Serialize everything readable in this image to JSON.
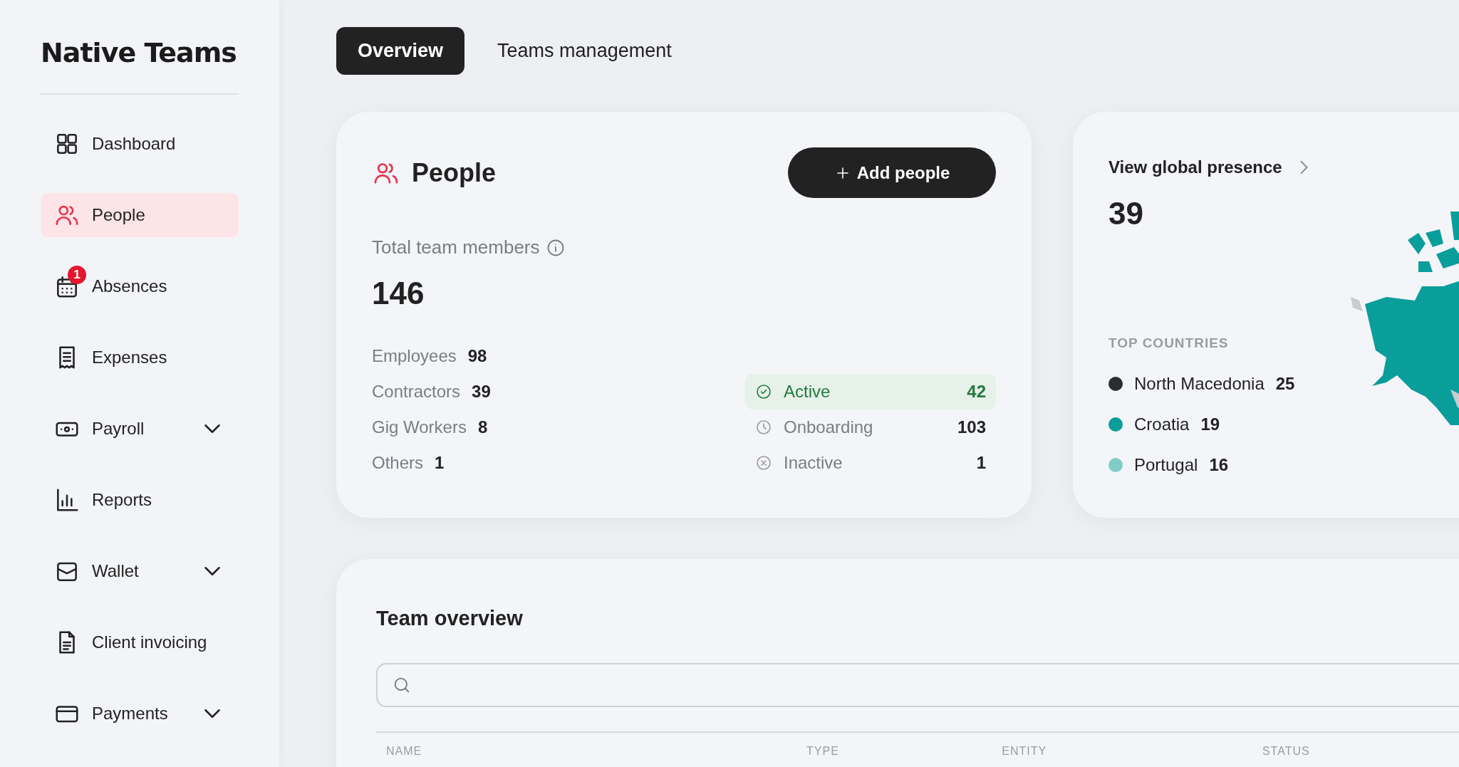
{
  "logo": "Native Teams",
  "sidebar": {
    "items": [
      {
        "label": "Dashboard",
        "selected": false,
        "expandable": false
      },
      {
        "label": "People",
        "selected": true,
        "expandable": false
      },
      {
        "label": "Absences",
        "selected": false,
        "expandable": false,
        "badge": "1"
      },
      {
        "label": "Expenses",
        "selected": false,
        "expandable": false
      },
      {
        "label": "Payroll",
        "selected": false,
        "expandable": true
      },
      {
        "label": "Reports",
        "selected": false,
        "expandable": false
      },
      {
        "label": "Wallet",
        "selected": false,
        "expandable": true
      },
      {
        "label": "Client invoicing",
        "selected": false,
        "expandable": false
      },
      {
        "label": "Payments",
        "selected": false,
        "expandable": true
      }
    ]
  },
  "tabs": [
    {
      "label": "Overview",
      "selected": true
    },
    {
      "label": "Teams management",
      "selected": false
    }
  ],
  "people_card": {
    "title": "People",
    "add_button": "Add people",
    "total_label": "Total team members",
    "total": "146",
    "types": [
      {
        "label": "Employees",
        "value": "98"
      },
      {
        "label": "Contractors",
        "value": "39"
      },
      {
        "label": "Gig Workers",
        "value": "8"
      },
      {
        "label": "Others",
        "value": "1"
      }
    ],
    "statuses": [
      {
        "kind": "active",
        "label": "Active",
        "value": "42",
        "selected": true
      },
      {
        "kind": "onboarding",
        "label": "Onboarding",
        "value": "103",
        "selected": false
      },
      {
        "kind": "inactive",
        "label": "Inactive",
        "value": "1",
        "selected": false
      }
    ]
  },
  "global_card": {
    "link": "View global presence",
    "count": "39",
    "top_label": "TOP COUNTRIES",
    "countries": [
      {
        "name": "North Macedonia",
        "value": "25",
        "color": "#2b2d2f"
      },
      {
        "name": "Croatia",
        "value": "19",
        "color": "#0a9e9b"
      },
      {
        "name": "Portugal",
        "value": "16",
        "color": "#80cdc7"
      }
    ]
  },
  "team_overview": {
    "title": "Team overview",
    "columns": [
      "NAME",
      "TYPE",
      "ENTITY",
      "STATUS"
    ]
  }
}
